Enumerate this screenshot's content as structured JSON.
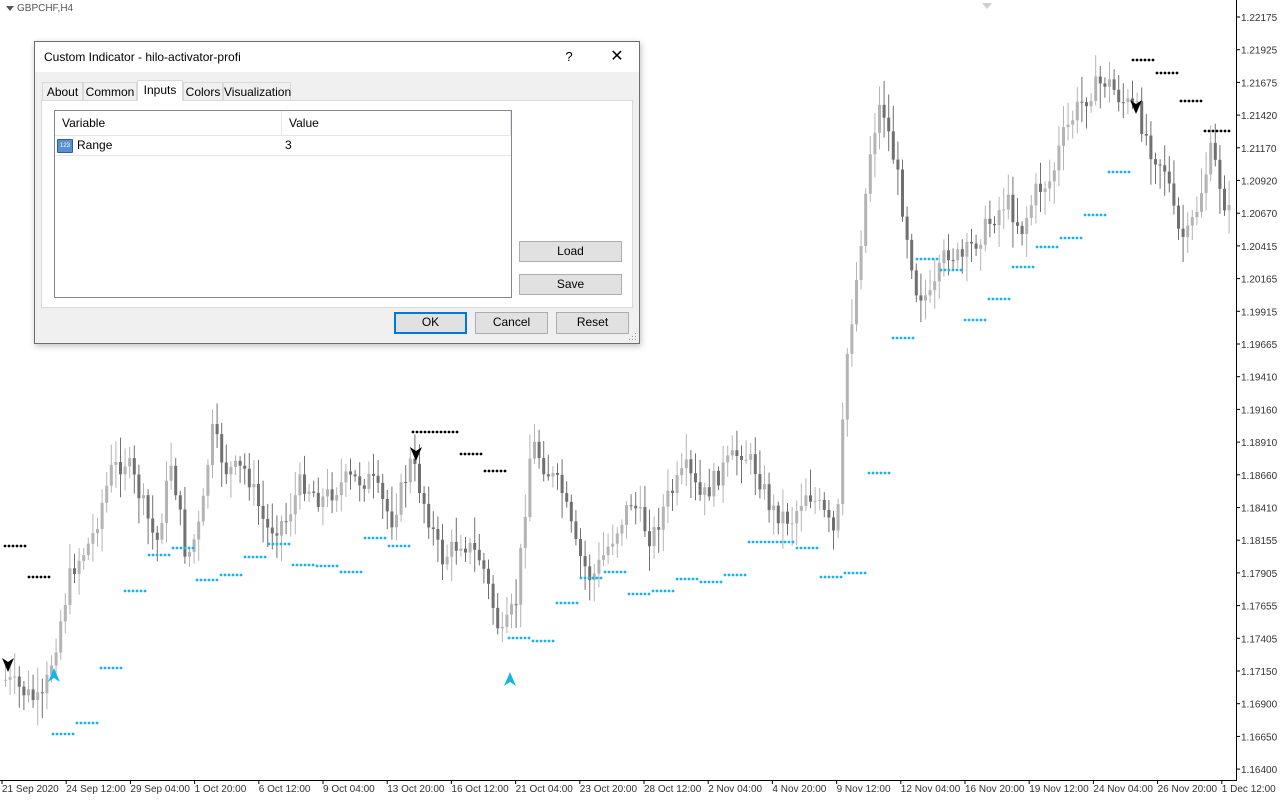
{
  "symbol": "GBPCHF,H4",
  "price_axis": {
    "labels": [
      "1.22175",
      "1.21925",
      "1.21675",
      "1.21420",
      "1.21170",
      "1.20920",
      "1.20670",
      "1.20415",
      "1.20165",
      "1.19915",
      "1.19665",
      "1.19410",
      "1.19160",
      "1.18910",
      "1.18660",
      "1.18410",
      "1.18155",
      "1.17905",
      "1.17655",
      "1.17405",
      "1.17150",
      "1.16900",
      "1.16650",
      "1.16400"
    ]
  },
  "time_axis": {
    "labels": [
      "21 Sep 2020",
      "24 Sep 12:00",
      "29 Sep 04:00",
      "1 Oct 20:00",
      "6 Oct 12:00",
      "9 Oct 04:00",
      "13 Oct 20:00",
      "16 Oct 12:00",
      "21 Oct 04:00",
      "23 Oct 20:00",
      "28 Oct 12:00",
      "2 Nov 04:00",
      "4 Nov 20:00",
      "9 Nov 12:00",
      "12 Nov 04:00",
      "16 Nov 20:00",
      "19 Nov 12:00",
      "24 Nov 04:00",
      "26 Nov 20:00",
      "1 Dec 12:00"
    ]
  },
  "colors": {
    "bull_candle": "#b4b4b4",
    "bear_candle": "#707070",
    "hilo_low": "#19b4e6",
    "hilo_high": "#000000",
    "axis_text": "#333333"
  },
  "dialog": {
    "title": "Custom Indicator - hilo-activator-profi",
    "help_label": "?",
    "close_label": "✕",
    "tabs": [
      {
        "label": "About",
        "active": false
      },
      {
        "label": "Common",
        "active": false
      },
      {
        "label": "Inputs",
        "active": true
      },
      {
        "label": "Colors",
        "active": false
      },
      {
        "label": "Visualization",
        "active": false
      }
    ],
    "table": {
      "headers": [
        "Variable",
        "Value"
      ],
      "rows": [
        {
          "icon": "numeric-input-icon",
          "icon_text": "123",
          "variable": "Range",
          "value": "3"
        }
      ]
    },
    "buttons": {
      "load": "Load",
      "save": "Save",
      "ok": "OK",
      "cancel": "Cancel",
      "reset": "Reset"
    }
  }
}
